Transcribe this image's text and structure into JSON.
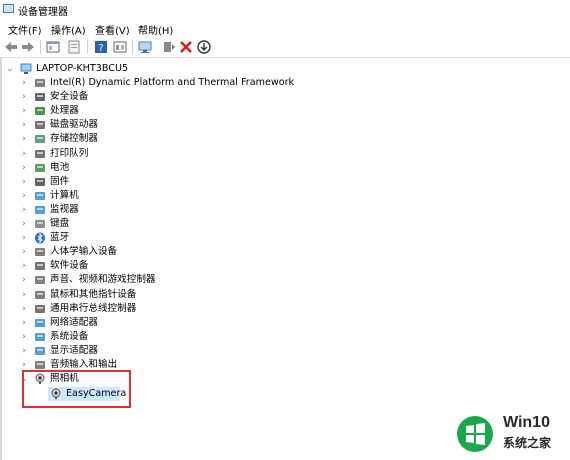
{
  "window": {
    "title": "设备管理器"
  },
  "menu": [
    "文件(F)",
    "操作(A)",
    "查看(V)",
    "帮助(H)"
  ],
  "toolbar": {
    "buttons": [
      "back-icon",
      "forward-icon",
      "properties-icon",
      "show-hidden-icon",
      "help-icon",
      "view-icon",
      "scan-monitor-icon",
      "update-driver-icon",
      "uninstall-icon",
      "download-icon"
    ]
  },
  "tree": {
    "root": "LAPTOP-KHT3BCU5",
    "categories": [
      "Intel(R) Dynamic Platform and Thermal Framework",
      "安全设备",
      "处理器",
      "磁盘驱动器",
      "存储控制器",
      "打印队列",
      "电池",
      "固件",
      "计算机",
      "监视器",
      "键盘",
      "蓝牙",
      "人体学输入设备",
      "软件设备",
      "声音、视频和游戏控制器",
      "鼠标和其他指针设备",
      "通用串行总线控制器",
      "网络适配器",
      "系统设备",
      "显示适配器",
      "音频输入和输出",
      "照相机"
    ],
    "camera_child": "EasyCamera"
  },
  "watermark": {
    "line1": "Win10",
    "line2": "系统之家"
  }
}
